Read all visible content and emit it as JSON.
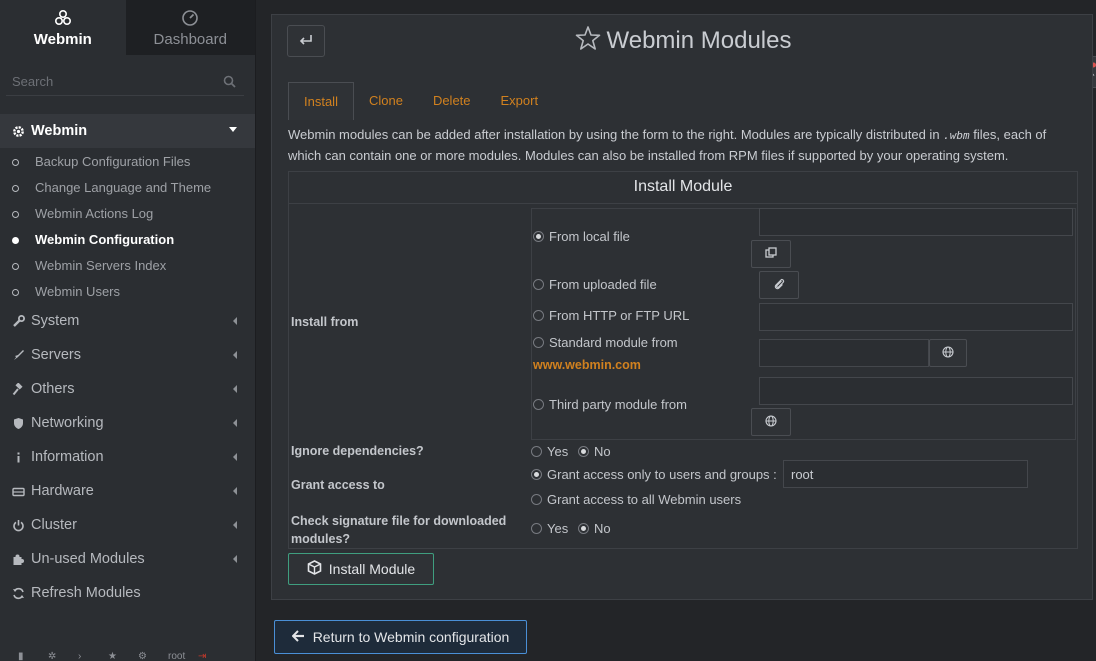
{
  "sidebar": {
    "brand_tab": "Webmin",
    "dashboard_tab": "Dashboard",
    "search_placeholder": "Search",
    "categories": {
      "webmin": "Webmin",
      "system": "System",
      "servers": "Servers",
      "others": "Others",
      "networking": "Networking",
      "information": "Information",
      "hardware": "Hardware",
      "cluster": "Cluster",
      "unused": "Un-used Modules",
      "refresh": "Refresh Modules"
    },
    "webmin_items": [
      "Backup Configuration Files",
      "Change Language and Theme",
      "Webmin Actions Log",
      "Webmin Configuration",
      "Webmin Servers Index",
      "Webmin Users"
    ],
    "bottom_user": "root"
  },
  "page": {
    "title": "Webmin Modules",
    "tabs": [
      "Install",
      "Clone",
      "Delete",
      "Export"
    ],
    "description_before": "Webmin modules can be added after installation by using the form to the right. Modules are typically distributed in ",
    "description_code": ".wbm",
    "description_after": " files, each of which can contain one or more modules. Modules can also be installed from RPM files if supported by your operating system."
  },
  "form": {
    "header": "Install Module",
    "install_from_label": "Install from",
    "options": {
      "local": "From local file",
      "uploaded": "From uploaded file",
      "http": "From HTTP or FTP URL",
      "standard": "Standard module from",
      "standard_link": "www.webmin.com",
      "third_party": "Third party module from"
    },
    "ignore_deps_label": "Ignore dependencies?",
    "grant_label": "Grant access to",
    "grant_only": "Grant access only to users and groups :",
    "grant_only_value": "root",
    "grant_all": "Grant access to all Webmin users",
    "check_sig_label": "Check signature file for downloaded modules?",
    "yes": "Yes",
    "no": "No",
    "install_button": "Install Module"
  },
  "footer": {
    "return_button": "Return to Webmin configuration"
  },
  "colors": {
    "accent_orange": "#d1811f",
    "install_border": "#3f9e7f",
    "return_border": "#4a8fd6"
  }
}
